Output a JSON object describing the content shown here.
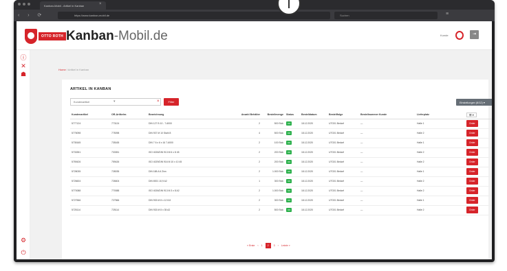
{
  "browser": {
    "tab_title": "Kanban-Mobil - Artikel in Kanban",
    "tab_close": "×",
    "url": "https://www.kanban-mobil.de",
    "search_placeholder": "Suchen",
    "nav_buttons": "‹ › ⟳",
    "menu_icon": "≡"
  },
  "header": {
    "logo_text": "OTTO ROTH",
    "brand_bold": "Kanban",
    "brand_rest": "-Mobil.de",
    "user_label": "Kunde",
    "logout_icon": "⇥"
  },
  "sidebar": {
    "icons": [
      "info-icon",
      "close-icon",
      "hierarchy-icon",
      "settings-icon",
      "power-icon"
    ]
  },
  "breadcrumb": {
    "home": "Home",
    "separator": " / ",
    "current": "Artikel in Kanban"
  },
  "panel": {
    "title": "ARTIKEL IN KANBAN",
    "filter_placeholder": "Kundenartikel",
    "filter_caret": "▾",
    "filter_clear": "×",
    "filter_button": "Filter",
    "columns_button": "Einstellungen (8/12)",
    "columns_caret": "▾",
    "print_icon": "⎙"
  },
  "table": {
    "headers": [
      "Kundenartikel",
      "OR-Artikelnr.",
      "Bezeichnung",
      "Anzahl Behälter",
      "Bestellmenge",
      "Status",
      "Bestelldatum",
      "Bestellfolge",
      "Bestellnummer Kunde",
      "Lieferplatz",
      ""
    ],
    "settings_label": "☰ ▾",
    "status_label": "OK",
    "order_label": "Order",
    "rows": [
      {
        "kunden": "5777124",
        "or": "773124",
        "bez": "DIN 127 B 10 - 7-6000",
        "anzahl": "2",
        "menge": "500 Stck",
        "datum": "18.12.2020",
        "folge": "UTG01 Bedarf",
        "bnr": "—",
        "platz": "Halle 1"
      },
      {
        "kunden": "5775098",
        "or": "775098",
        "bez": "DIN 937 M 10 Stahl 8",
        "anzahl": "4",
        "menge": "500 Stck",
        "datum": "18.12.2020",
        "folge": "UTG01 Bedarf",
        "bnr": "—",
        "platz": "Halle 2"
      },
      {
        "kunden": "5735165",
        "or": "735165",
        "bez": "DIN 7 6 x 6 x 16 7-6000",
        "anzahl": "2",
        "menge": "100 Stck",
        "datum": "18.12.2020",
        "folge": "UTG01 Bedarf",
        "bnr": "—",
        "platz": "Halle 1"
      },
      {
        "kunden": "5733351",
        "or": "733351",
        "bez": "ISO 4026/DIN 913 M 6 x 8 45",
        "anzahl": "2",
        "menge": "200 Stck",
        "datum": "18.12.2020",
        "folge": "UTG01 Bedarf",
        "bnr": "—",
        "platz": "Halle 2"
      },
      {
        "kunden": "5759426",
        "or": "759426",
        "bez": "ISO 4029/DIN 916 M 10 x 10 45",
        "anzahl": "2",
        "menge": "200 Stck",
        "datum": "18.12.2020",
        "folge": "UTG01 Bedarf",
        "bnr": "—",
        "platz": "Halle 2"
      },
      {
        "kunden": "5728035",
        "or": "728035",
        "bez": "DIN 188 A 6 Zinn",
        "anzahl": "2",
        "menge": "1.000 Stck",
        "datum": "18.12.2020",
        "folge": "UTG01 Bedarf",
        "bnr": "—",
        "platz": "Halle 1"
      },
      {
        "kunden": "5726604",
        "or": "726604",
        "bez": "DIN 6921 10,9 A2",
        "anzahl": "1",
        "menge": "300 Stck",
        "datum": "18.12.2020",
        "folge": "UTG01 Bedarf",
        "bnr": "—",
        "platz": "Halle 2"
      },
      {
        "kunden": "5770088",
        "or": "770088",
        "bez": "ISO 4026/DIN 913 M 3 x 8 A2",
        "anzahl": "2",
        "menge": "1.000 Stck",
        "datum": "18.12.2020",
        "folge": "UTG01 Bedarf",
        "bnr": "—",
        "platz": "Halle 2"
      },
      {
        "kunden": "5727566",
        "or": "727566",
        "bez": "DIN 933 M 8 x 12 8.8",
        "anzahl": "2",
        "menge": "300 Stck",
        "datum": "18.12.2020",
        "folge": "UTG01 Bedarf",
        "bnr": "—",
        "platz": "Halle 1"
      },
      {
        "kunden": "5725114",
        "or": "725114",
        "bez": "DIN 933 M 8 x 35 A2",
        "anzahl": "2",
        "menge": "500 Stck",
        "datum": "18.12.2020",
        "folge": "UTG01 Bedarf",
        "bnr": "—",
        "platz": "Halle 2"
      }
    ]
  },
  "pagination": {
    "first": "« Erste",
    "prev": "‹",
    "pages": [
      "1",
      "2",
      "3"
    ],
    "current": "2",
    "next": "›",
    "last": "Letzte »"
  },
  "colors": {
    "accent": "#d6242a",
    "status_ok": "#2bb04b",
    "toolbar_grey": "#666e76"
  }
}
